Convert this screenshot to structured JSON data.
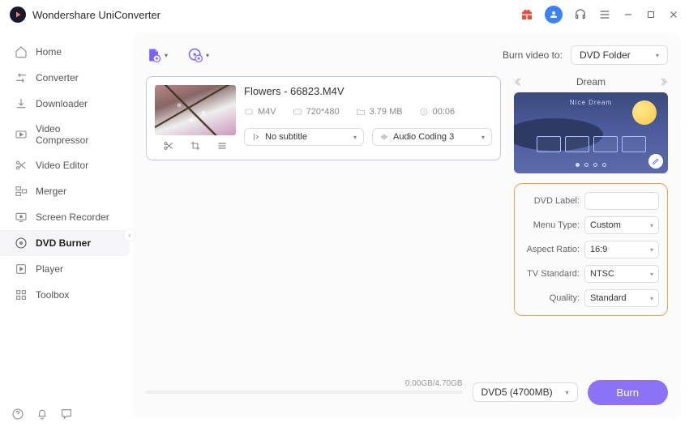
{
  "app": {
    "title": "Wondershare UniConverter"
  },
  "sidebar": {
    "items": [
      {
        "label": "Home"
      },
      {
        "label": "Converter"
      },
      {
        "label": "Downloader"
      },
      {
        "label": "Video Compressor"
      },
      {
        "label": "Video Editor"
      },
      {
        "label": "Merger"
      },
      {
        "label": "Screen Recorder"
      },
      {
        "label": "DVD Burner"
      },
      {
        "label": "Player"
      },
      {
        "label": "Toolbox"
      }
    ]
  },
  "toolbar": {
    "burn_to_label": "Burn video to:",
    "burn_to_value": "DVD Folder"
  },
  "file": {
    "name": "Flowers - 66823.M4V",
    "format": "M4V",
    "resolution": "720*480",
    "size": "3.79 MB",
    "duration": "00:06",
    "subtitle_value": "No subtitle",
    "audio_value": "Audio Coding 3"
  },
  "template": {
    "name": "Dream",
    "preview_title": "Nice Dream"
  },
  "settings": {
    "dvd_label_label": "DVD Label:",
    "dvd_label_value": "",
    "menu_type_label": "Menu Type:",
    "menu_type_value": "Custom",
    "aspect_ratio_label": "Aspect Ratio:",
    "aspect_ratio_value": "16:9",
    "tv_standard_label": "TV Standard:",
    "tv_standard_value": "NTSC",
    "quality_label": "Quality:",
    "quality_value": "Standard"
  },
  "footer": {
    "progress_text": "0.00GB/4.70GB",
    "disc_value": "DVD5 (4700MB)",
    "burn_label": "Burn"
  }
}
